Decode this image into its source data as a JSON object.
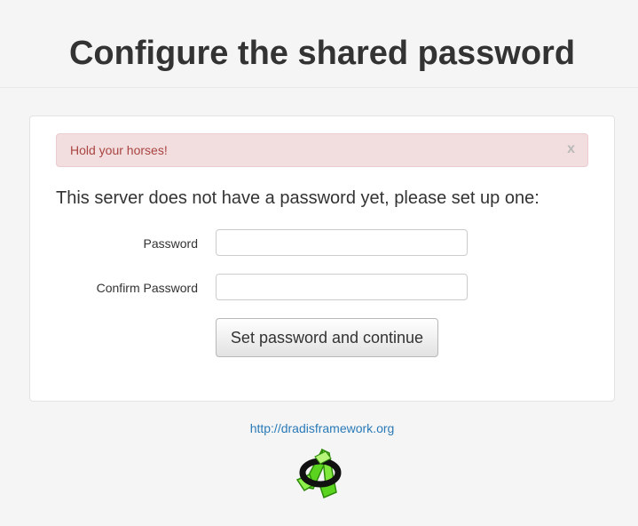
{
  "header": {
    "title": "Configure the shared password"
  },
  "alert": {
    "message": "Hold your horses!",
    "close_label": "x"
  },
  "form": {
    "intro": "This server does not have a password yet, please set up one:",
    "password_label": "Password",
    "password_value": "",
    "confirm_label": "Confirm Password",
    "confirm_value": "",
    "submit_label": "Set password and continue"
  },
  "footer": {
    "link_text": "http://dradisframework.org",
    "logo_icon": "dradis-logo-icon"
  },
  "colors": {
    "alert_background": "#f2dede",
    "alert_text": "#a94442",
    "link": "#2a7ab8",
    "logo_green": "#5ad41e"
  }
}
